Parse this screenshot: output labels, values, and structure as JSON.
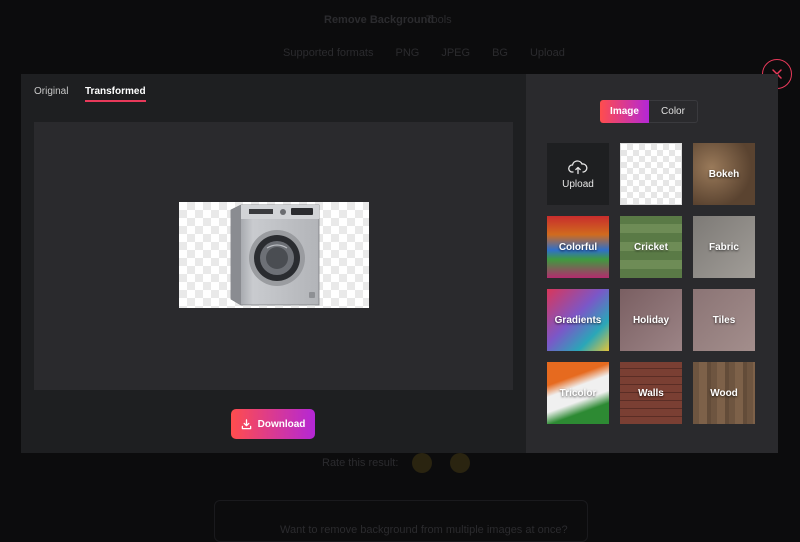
{
  "background_page": {
    "title": "Remove Background",
    "subtitle": "Tools",
    "nav_items": [
      "Supported formats",
      "PNG",
      "JPEG",
      "BG",
      "Upload"
    ],
    "feedback_label": "Rate this result:",
    "bottom_text": "Want to remove background from multiple images at once?"
  },
  "modal": {
    "tabs": {
      "original": "Original",
      "transformed": "Transformed",
      "active": "transformed"
    },
    "download_label": "Download",
    "close_icon": "close-icon"
  },
  "panel": {
    "toggle": {
      "image": "Image",
      "color": "Color",
      "active": "image"
    },
    "tiles": [
      {
        "label": "Upload",
        "icon": "cloud-upload-icon"
      },
      {
        "label": ""
      },
      {
        "label": "Bokeh"
      },
      {
        "label": "Colorful"
      },
      {
        "label": "Cricket"
      },
      {
        "label": "Fabric"
      },
      {
        "label": "Gradients"
      },
      {
        "label": "Holiday"
      },
      {
        "label": "Tiles"
      },
      {
        "label": "Tricolor"
      },
      {
        "label": "Walls"
      },
      {
        "label": "Wood"
      }
    ]
  },
  "colors": {
    "accent_start": "#ff4d4d",
    "accent_end": "#b427d6",
    "close_ring": "#e8395a"
  }
}
